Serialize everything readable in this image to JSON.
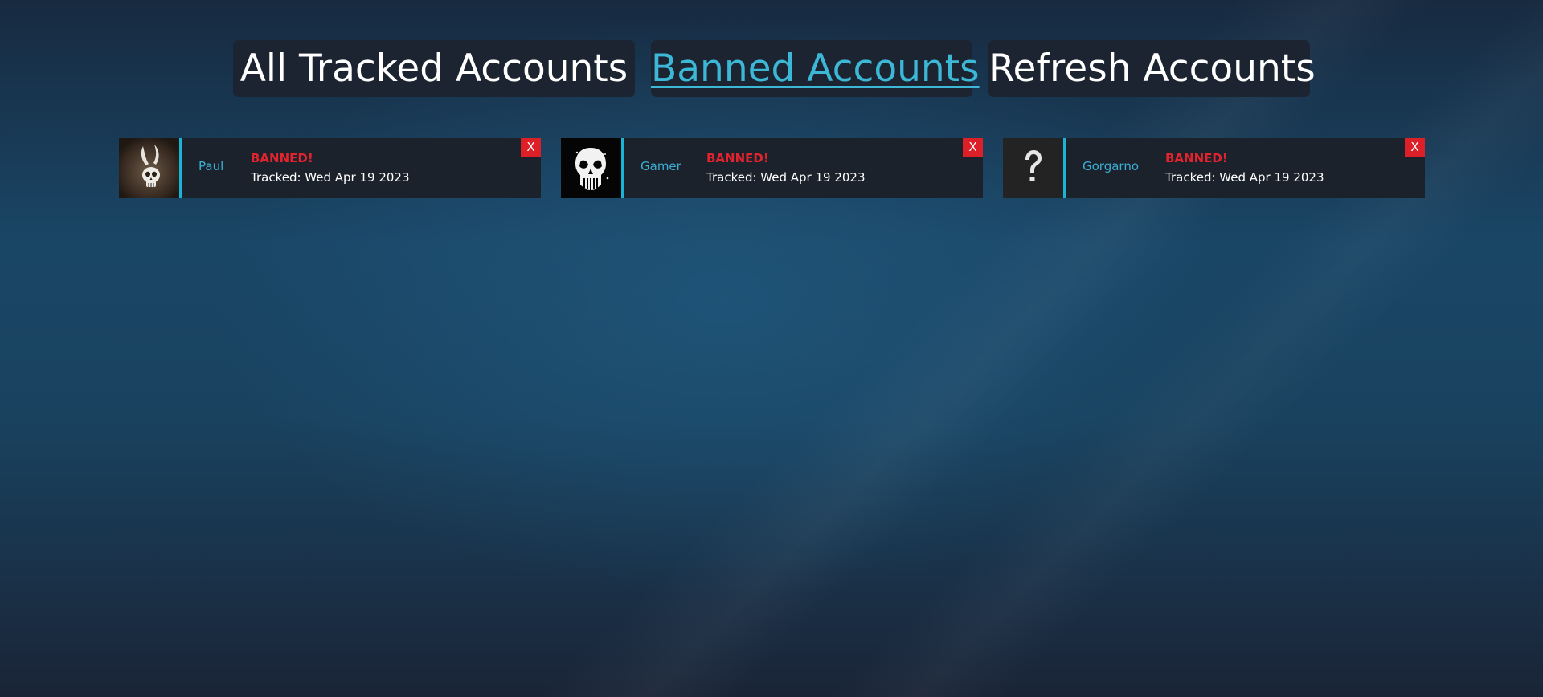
{
  "nav": {
    "all_label": "All Tracked Accounts",
    "banned_label": "Banned Accounts",
    "refresh_label": "Refresh Accounts"
  },
  "colors": {
    "accent": "#1ab4d8",
    "banned": "#e0232d",
    "link": "#3cb8d6",
    "card_bg": "#1c222c"
  },
  "accounts": [
    {
      "name": "Paul",
      "status": "BANNED!",
      "tracked": "Tracked: Wed Apr 19 2023",
      "close": "X",
      "avatar": "rabbit-skull-avatar"
    },
    {
      "name": "Gamer",
      "status": "BANNED!",
      "tracked": "Tracked: Wed Apr 19 2023",
      "close": "X",
      "avatar": "punisher-skull-avatar"
    },
    {
      "name": "Gorgarno",
      "status": "BANNED!",
      "tracked": "Tracked: Wed Apr 19 2023",
      "close": "X",
      "avatar": "question-mark-avatar"
    }
  ]
}
